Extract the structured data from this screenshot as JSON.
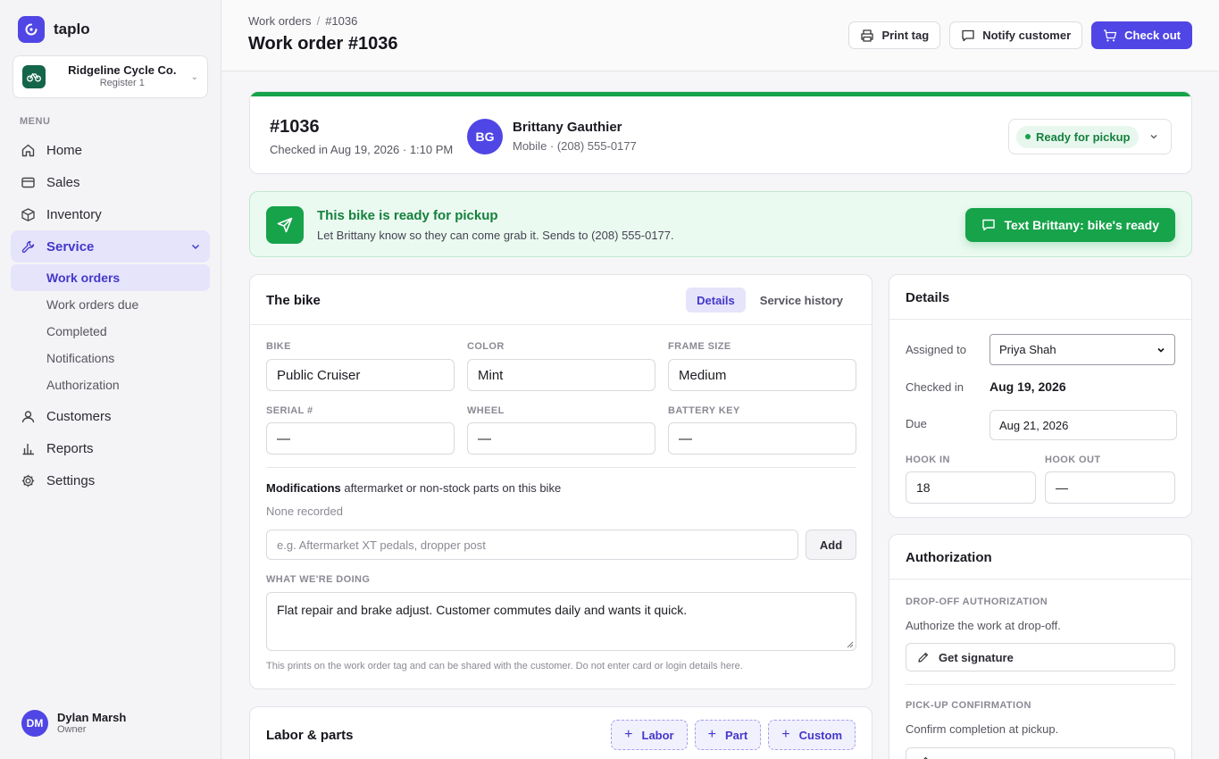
{
  "app": {
    "name": "taplo"
  },
  "store": {
    "name": "Ridgeline Cycle Co.",
    "register": "Register 1"
  },
  "sidebar": {
    "menu_label": "MENU",
    "items": [
      {
        "label": "Home"
      },
      {
        "label": "Sales"
      },
      {
        "label": "Inventory"
      },
      {
        "label": "Service"
      },
      {
        "label": "Customers"
      },
      {
        "label": "Reports"
      },
      {
        "label": "Settings"
      }
    ],
    "service_sub": [
      {
        "label": "Work orders"
      },
      {
        "label": "Work orders due"
      },
      {
        "label": "Completed"
      },
      {
        "label": "Notifications"
      },
      {
        "label": "Authorization"
      }
    ]
  },
  "user": {
    "initials": "DM",
    "name": "Dylan Marsh",
    "role": "Owner"
  },
  "header": {
    "breadcrumb_root": "Work orders",
    "breadcrumb_sep": "/",
    "breadcrumb_current": "#1036",
    "title": "Work order #1036",
    "print_label": "Print tag",
    "notify_label": "Notify customer",
    "checkout_label": "Check out"
  },
  "work_order": {
    "number": "#1036",
    "checked_in": "Checked in Aug 19, 2026 · 1:10 PM",
    "customer_initials": "BG",
    "customer_name": "Brittany Gauthier",
    "customer_phone": "Mobile · (208) 555-0177",
    "status": "Ready for pickup"
  },
  "banner": {
    "title": "This bike is ready for pickup",
    "subtitle": "Let Brittany know so they can come grab it. Sends to (208) 555-0177.",
    "button": "Text Brittany: bike's ready"
  },
  "bike": {
    "title": "The bike",
    "tab_details": "Details",
    "tab_history": "Service history",
    "fields": {
      "bike_label": "BIKE",
      "bike": "Public Cruiser",
      "color_label": "COLOR",
      "color": "Mint",
      "frame_label": "FRAME SIZE",
      "frame": "Medium",
      "serial_label": "SERIAL #",
      "serial": "—",
      "wheel_label": "WHEEL",
      "wheel": "—",
      "battery_label": "BATTERY KEY",
      "battery": "—"
    },
    "mods_title": "Modifications",
    "mods_desc": "aftermarket or non-stock parts on this bike",
    "mods_none": "None recorded",
    "mods_placeholder": "e.g. Aftermarket XT pedals, dropper post",
    "mods_add": "Add",
    "doing_label": "WHAT WE'RE DOING",
    "doing_text": "Flat repair and brake adjust. Customer commutes daily and wants it quick.",
    "doing_note": "This prints on the work order tag and can be shared with the customer. Do not enter card or login details here."
  },
  "labor": {
    "title": "Labor & parts",
    "labor_btn": "Labor",
    "part_btn": "Part",
    "custom_btn": "Custom"
  },
  "details": {
    "title": "Details",
    "assigned_label": "Assigned to",
    "assigned": "Priya Shah",
    "checked_label": "Checked in",
    "checked": "Aug 19, 2026",
    "due_label": "Due",
    "due": "Aug 21, 2026",
    "hook_in_label": "HOOK IN",
    "hook_in": "18",
    "hook_out_label": "HOOK OUT",
    "hook_out": "—"
  },
  "authorization": {
    "title": "Authorization",
    "dropoff_label": "DROP-OFF AUTHORIZATION",
    "dropoff_text": "Authorize the work at drop-off.",
    "signature_btn": "Get signature",
    "pickup_label": "PICK-UP CONFIRMATION",
    "pickup_text": "Confirm completion at pickup."
  },
  "colors": {
    "accent": "#5046e5",
    "success": "#16a34a"
  }
}
